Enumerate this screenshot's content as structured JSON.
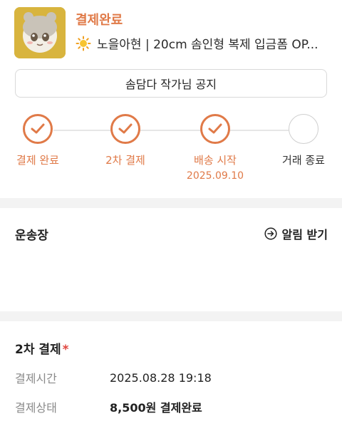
{
  "order": {
    "status": "결제완료",
    "product_title": "노을아현 | 20cm 솜인형 복제 입금폼 OP...",
    "product_emoji_icon": "sun-icon",
    "thumbnail_text": ""
  },
  "notice_button": {
    "label": "솜담다 작가님 공지"
  },
  "progress": {
    "steps": [
      {
        "label": "결제 완료",
        "done": true,
        "date": ""
      },
      {
        "label": "2차 결제",
        "done": true,
        "date": ""
      },
      {
        "label": "배송 시작",
        "done": true,
        "date": "2025.09.10"
      },
      {
        "label": "거래 종료",
        "done": false,
        "date": ""
      }
    ],
    "accent_color": "#e07a48"
  },
  "tracking": {
    "title": "운송장",
    "alert_label": "알림 받기"
  },
  "payment": {
    "title": "2차 결제",
    "required_mark": "*",
    "rows": [
      {
        "key": "결제시간",
        "value": "2025.08.28 19:18"
      },
      {
        "key": "결제상태",
        "value": "8,500원 결제완료"
      }
    ]
  }
}
